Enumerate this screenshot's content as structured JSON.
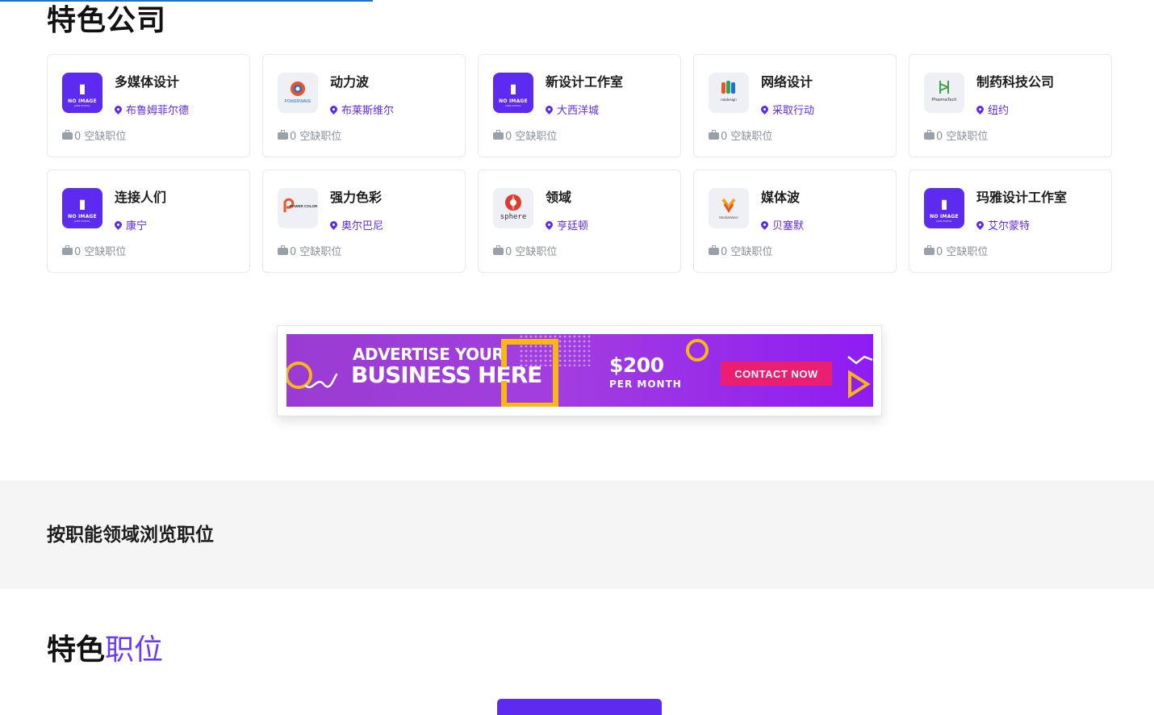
{
  "featured_companies": {
    "title": "特色公司",
    "companies": [
      {
        "name": "多媒体设计",
        "location": "布鲁姆菲尔德",
        "jobs": "0 空缺职位",
        "logo": "no-image-logo"
      },
      {
        "name": "动力波",
        "location": "布莱斯维尔",
        "jobs": "0 空缺职位",
        "logo": "power-wave-logo"
      },
      {
        "name": "新设计工作室",
        "location": "大西洋城",
        "jobs": "0 空缺职位",
        "logo": "no-image-logo"
      },
      {
        "name": "网络设计",
        "location": "采取行动",
        "jobs": "0 空缺职位",
        "logo": "net-design-logo"
      },
      {
        "name": "制药科技公司",
        "location": "纽约",
        "jobs": "0 空缺职位",
        "logo": "pharmatech-logo"
      },
      {
        "name": "连接人们",
        "location": "康宁",
        "jobs": "0 空缺职位",
        "logo": "no-image-logo"
      },
      {
        "name": "强力色彩",
        "location": "奥尔巴尼",
        "jobs": "0 空缺职位",
        "logo": "power-color-logo"
      },
      {
        "name": "领域",
        "location": "亨廷顿",
        "jobs": "0 空缺职位",
        "logo": "sphere-logo"
      },
      {
        "name": "媒体波",
        "location": "贝塞默",
        "jobs": "0 空缺职位",
        "logo": "media-wave-logo"
      },
      {
        "name": "玛雅设计工作室",
        "location": "艾尔蒙特",
        "jobs": "0 空缺职位",
        "logo": "no-image-logo"
      }
    ],
    "no_image": {
      "text": "NO IMAGE",
      "sub": "JOBS PORTAL"
    },
    "logo_texts": {
      "power_wave": "POWERWAVE",
      "net_design": "netdesign",
      "pharmatech": "PharmaTech",
      "power_color": "POWER COLOR",
      "sphere": "sphere",
      "media_wave": "MediaWave"
    }
  },
  "ad_banner": {
    "line1": "ADVERTISE YOUR",
    "line2": "BUSINESS HERE",
    "price": "$200",
    "per": "PER MONTH",
    "cta": "CONTACT NOW",
    "colors": {
      "accent": "#f8b716",
      "cta": "#ea1f72",
      "bg_start": "#9a3cd2",
      "bg_end": "#8f1cf2"
    }
  },
  "browse": {
    "title": "按职能领域浏览职位"
  },
  "featured_jobs": {
    "title_bold": "特色",
    "title_light": "职位"
  },
  "colors": {
    "primary": "#5d2bf0",
    "muted": "#8a8f99",
    "section_bg": "#f5f5f5"
  }
}
